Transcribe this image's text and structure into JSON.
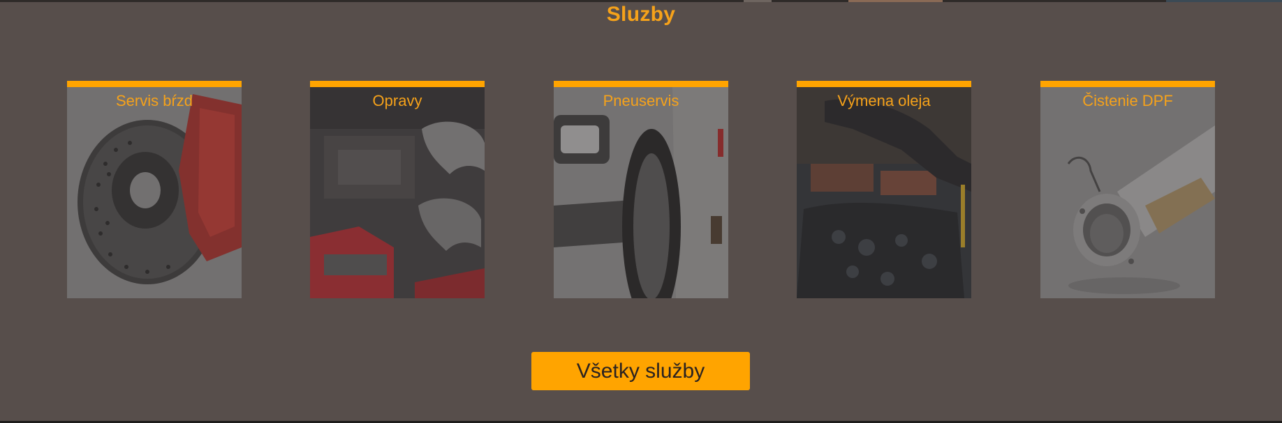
{
  "section": {
    "title": "Sluzby"
  },
  "services": [
    {
      "label": "Servis bŕzd",
      "icon": "brake-disc-image"
    },
    {
      "label": "Opravy",
      "icon": "engine-wrench-image"
    },
    {
      "label": "Pneuservis",
      "icon": "car-tire-image"
    },
    {
      "label": "Výmena oleja",
      "icon": "oil-change-image"
    },
    {
      "label": "Čistenie DPF",
      "icon": "dpf-filter-image"
    }
  ],
  "cta": {
    "label": "Všetky služby"
  },
  "colors": {
    "accent": "#ffa400",
    "title": "#f6a21a",
    "background": "#574e4b"
  }
}
